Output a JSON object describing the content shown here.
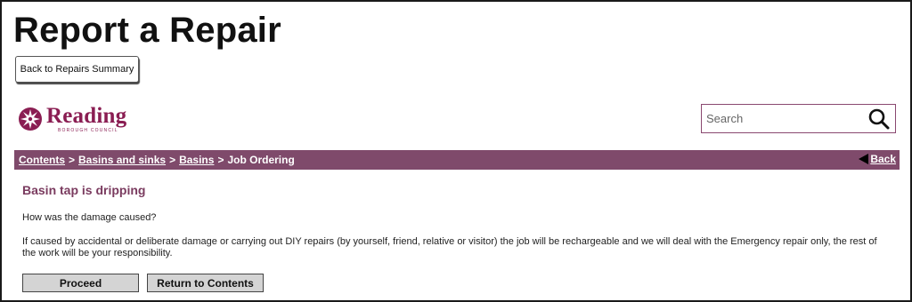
{
  "header": {
    "title": "Report a Repair",
    "back_summary_label": "Back to Repairs Summary"
  },
  "logo": {
    "name": "Reading",
    "subtitle": "BOROUGH COUNCIL",
    "brand_color": "#8a1d52"
  },
  "search": {
    "placeholder": "Search",
    "value": ""
  },
  "breadcrumb": {
    "items": [
      "Contents",
      "Basins and sinks",
      "Basins"
    ],
    "separator": ">",
    "current": "Job Ordering",
    "back_label": "Back",
    "bar_color": "#7f4a6b"
  },
  "main": {
    "heading": "Basin tap is dripping",
    "question": "How was the damage caused?",
    "info": "If caused by accidental or deliberate damage or carrying out DIY repairs (by yourself, friend, relative or visitor) the job will be rechargeable and we will deal with the Emergency repair only, the rest of the work will be your responsibility."
  },
  "actions": {
    "proceed_label": "Proceed",
    "return_label": "Return to Contents"
  }
}
